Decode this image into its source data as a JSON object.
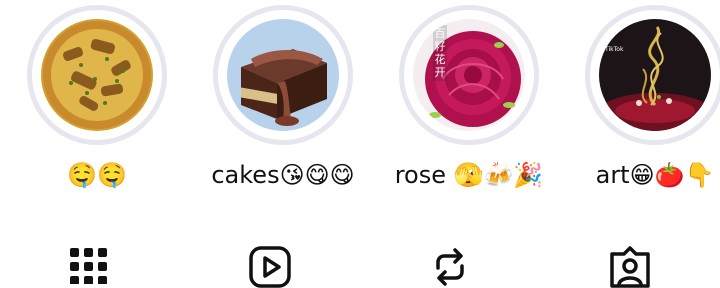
{
  "highlights": [
    {
      "label": "🤤🤤",
      "thumbnail": "food-dish",
      "accent": "#c98a2e"
    },
    {
      "label": "cakes😘😋😋",
      "thumbnail": "chocolate-cake",
      "accent": "#7a4330"
    },
    {
      "label": "rose 🫣🍻🎉",
      "thumbnail": "rose-cake",
      "accent": "#b0104e",
      "overlay_text": [
        "百",
        "籽",
        "花",
        "开"
      ]
    },
    {
      "label": "art😁🍅👇",
      "thumbnail": "plated-art",
      "accent": "#a01830",
      "overlay_text": [
        "TikTok"
      ]
    }
  ],
  "tabs": [
    {
      "icon": "grid-icon",
      "active": true
    },
    {
      "icon": "reels-icon",
      "active": false
    },
    {
      "icon": "reposts-icon",
      "active": false
    },
    {
      "icon": "tagged-icon",
      "active": false
    }
  ]
}
